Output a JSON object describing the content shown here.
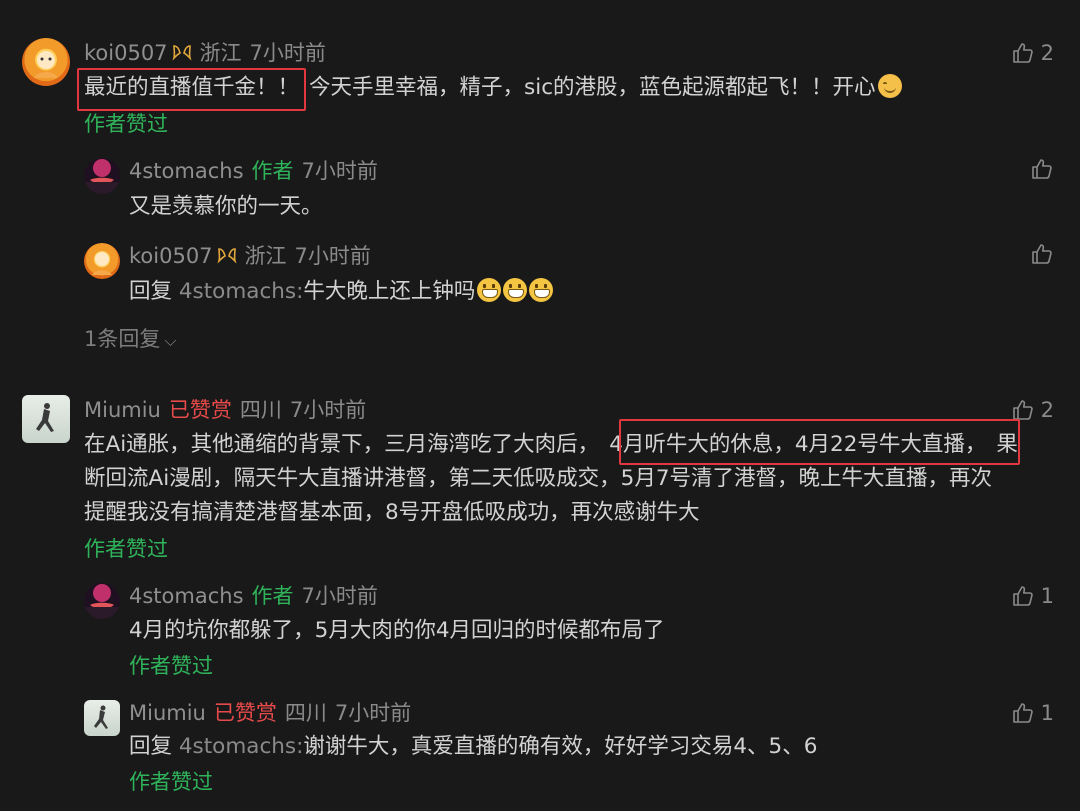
{
  "comments": [
    {
      "name": "koi0507",
      "location": "浙江",
      "time": "7小时前",
      "likes": "2",
      "text_highlight": "最近的直播值千金！！",
      "text_rest": "今天手里幸福，精子，sic的港股，蓝色起源都起飞！！开心",
      "liked_by_author": "作者赞过",
      "replies": [
        {
          "name": "4stomachs",
          "author_tag": "作者",
          "time": "7小时前",
          "text": "又是羡慕你的一天。"
        },
        {
          "name": "koi0507",
          "location": "浙江",
          "time": "7小时前",
          "reply_prefix": "回复",
          "reply_to": "4stomachs:",
          "text": "牛大晚上还上钟吗"
        }
      ],
      "more_replies": "1条回复"
    },
    {
      "name": "Miumiu",
      "tip_tag": "已赞赏",
      "location": "四川",
      "time": "7小时前",
      "likes": "2",
      "line1_a": "在Ai通胀，其他通缩的背景下，三月海湾吃了大肉后，",
      "line1_highlight": "4月听牛大的休息，4月22号牛大直播，",
      "line1_b": "果",
      "line2": "断回流Ai漫剧，隔天牛大直播讲港督，第二天低吸成交，5月7号清了港督，晚上牛大直播，再次",
      "line3": "提醒我没有搞清楚港督基本面，8号开盘低吸成功，再次感谢牛大",
      "liked_by_author": "作者赞过",
      "replies": [
        {
          "name": "4stomachs",
          "author_tag": "作者",
          "time": "7小时前",
          "likes": "1",
          "text": "4月的坑你都躲了，5月大肉的你4月回归的时候都布局了",
          "liked_by_author": "作者赞过"
        },
        {
          "name": "Miumiu",
          "tip_tag": "已赞赏",
          "location": "四川",
          "time": "7小时前",
          "likes": "1",
          "reply_prefix": "回复",
          "reply_to": "4stomachs:",
          "text": "谢谢牛大，真爱直播的确有效，好好学习交易4、5、6",
          "liked_by_author": "作者赞过"
        }
      ]
    }
  ],
  "icons": {
    "like": "thumbs-up-icon",
    "badge": "gold-ribbon-badge-icon",
    "chevron": "chevron-down-icon"
  },
  "colors": {
    "author_green": "#2fb35a",
    "tipped_red": "#e64a4a",
    "highlight_box": "#e0383e"
  }
}
